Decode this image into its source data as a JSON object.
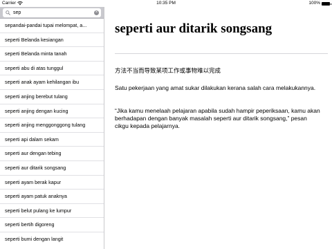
{
  "status_bar": {
    "carrier": "Carrier",
    "time": "10:35 PM",
    "battery": "100%"
  },
  "search": {
    "value": "sep",
    "placeholder": ""
  },
  "list": {
    "items": [
      "sepandai-pandai tupai melompat, a...",
      "seperti Belanda kesiangan",
      "seperti Belanda minta tanah",
      "seperti abu di atas tunggul",
      "seperti anak ayam kehilangan ibu",
      "seperti anjing berebut tulang",
      "seperti anjing dengan kucing",
      "seperti anjing menggonggong tulang",
      "seperti api dalam sekam",
      "seperti aur dengan tebing",
      "seperti aur ditarik songsang",
      "seperti ayam berak kapur",
      "seperti ayam patuk anaknya",
      "seperti belut pulang ke lumpur",
      "seperti bertih digoreng",
      "seperti bumi dengan langit"
    ]
  },
  "detail": {
    "title": "seperti aur ditarik songsang",
    "chinese": "方法不当而导致某项工作或事物难以完成",
    "malay": "Satu pekerjaan yang amat sukar dilakukan kerana salah cara melakukannya.",
    "example": "“Jika kamu menelaah pelajaran apabila sudah hampir peperiksaan, kamu akan berhadapan dengan banyak masalah seperti aur ditarik songsang,” pesan cikgu kepada pelajarnya."
  }
}
